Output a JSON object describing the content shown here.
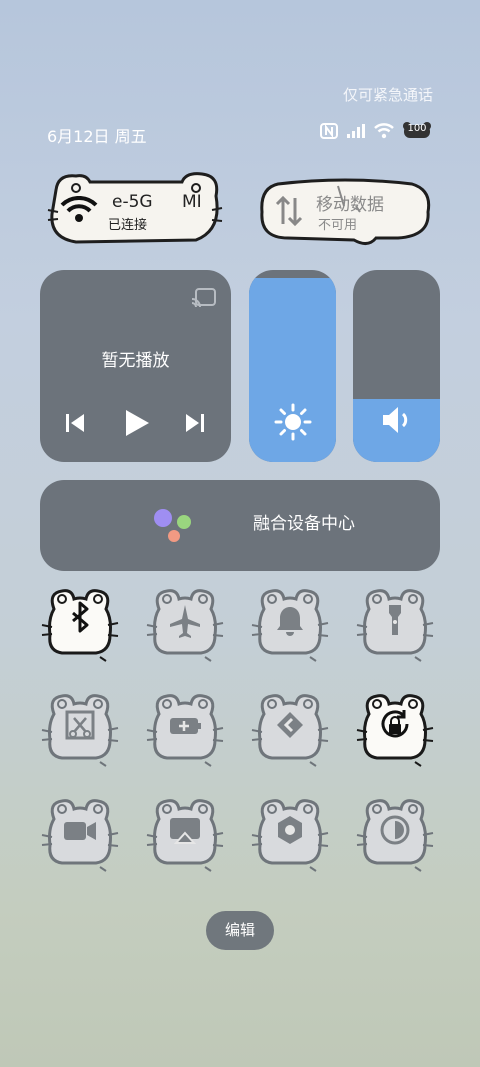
{
  "header": {
    "emergency_text": "仅可紧急通话",
    "date_text": "6月12日 周五",
    "battery_level": "100"
  },
  "tiles": {
    "wifi": {
      "name": "e-5G",
      "status": "已连接",
      "extra": "MI"
    },
    "mobile_data": {
      "name": "移动数据",
      "status": "不可用"
    }
  },
  "media": {
    "title": "暂无播放"
  },
  "sliders": {
    "brightness_level": 0.96,
    "volume_level": 0.33
  },
  "device_hub": {
    "label": "融合设备中心"
  },
  "toggles": [
    {
      "icon": "bluetooth-icon",
      "active": true
    },
    {
      "icon": "airplane-icon",
      "active": false
    },
    {
      "icon": "bell-icon",
      "active": false
    },
    {
      "icon": "flashlight-icon",
      "active": false
    },
    {
      "icon": "screenshot-icon",
      "active": false
    },
    {
      "icon": "battery-saver-icon",
      "active": false
    },
    {
      "icon": "cast-icon",
      "active": false
    },
    {
      "icon": "rotation-lock-icon",
      "active": true
    },
    {
      "icon": "screen-record-icon",
      "active": false
    },
    {
      "icon": "screen-mirror-icon",
      "active": false
    },
    {
      "icon": "settings-hex-icon",
      "active": false
    },
    {
      "icon": "dark-mode-icon",
      "active": false
    }
  ],
  "footer": {
    "edit_label": "编辑"
  },
  "colors": {
    "accent_blue": "#6ea7e6",
    "card_gray": "#6c737b",
    "toggle_gray": "#7b8085"
  }
}
